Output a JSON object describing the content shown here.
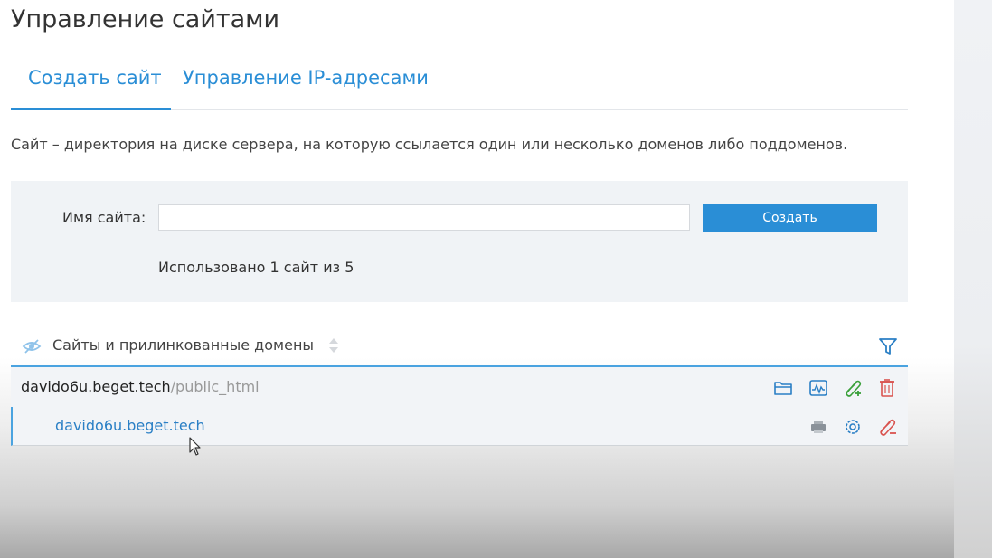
{
  "page": {
    "title": "Управление сайтами"
  },
  "tabs": [
    {
      "label": "Создать сайт",
      "active": true
    },
    {
      "label": "Управление IP-адресами",
      "active": false
    }
  ],
  "description": "Сайт – директория на диске сервера, на которую ссылается один или несколько доменов либо поддоменов.",
  "form": {
    "name_label": "Имя сайта:",
    "name_value": "",
    "create_button": "Создать",
    "usage_text": "Использовано 1 сайт из 5"
  },
  "sites_list": {
    "header_label": "Сайты и прилинкованные домены",
    "sites": [
      {
        "host": "davido6u.beget.tech",
        "path": "/public_html",
        "action_icons": [
          "folder-icon",
          "stats-icon",
          "add-link-icon",
          "delete-icon"
        ],
        "domains": [
          {
            "name": "davido6u.beget.tech",
            "action_icons": [
              "printer-icon",
              "settings-icon",
              "unlink-icon"
            ]
          }
        ]
      }
    ]
  },
  "colors": {
    "accent": "#2a8ed6",
    "link": "#2a7fc5",
    "panel_bg": "#f0f3f6",
    "danger": "#d9534f",
    "success": "#3aa03a"
  }
}
